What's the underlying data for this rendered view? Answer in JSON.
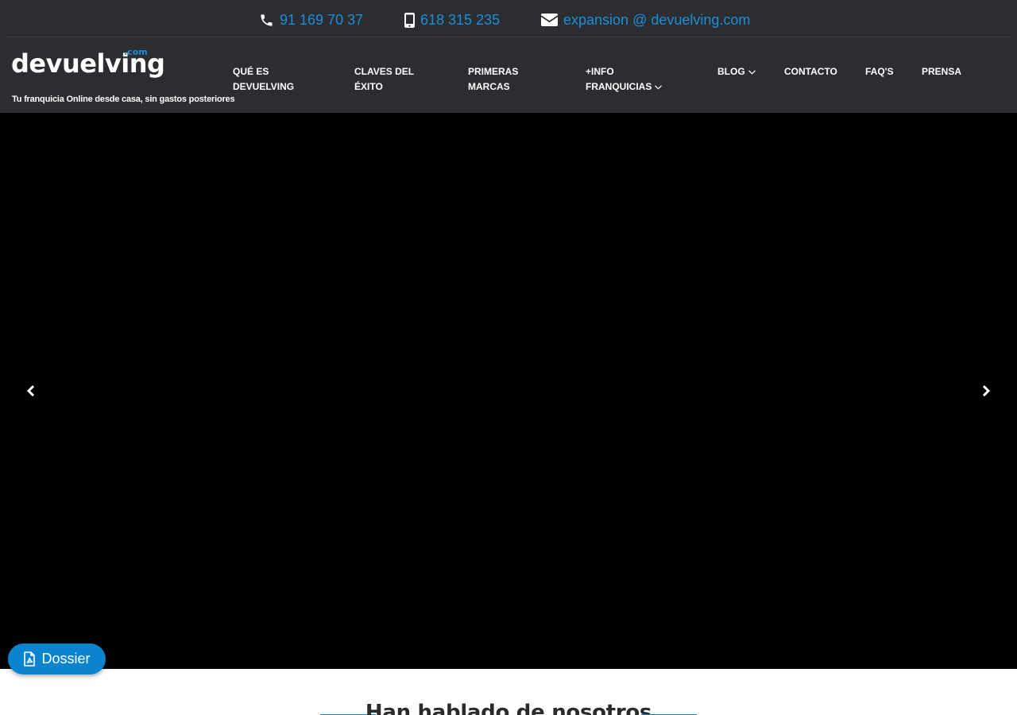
{
  "contact": {
    "phone": "91 169 70 37",
    "mobile": "618 315 235",
    "email": "expansion @ devuelving.com"
  },
  "brand": {
    "logo_text": "devuelving",
    "logo_suffix": ".com",
    "tagline": "Tu franquicia Online desde casa, sin gastos posteriores"
  },
  "nav": {
    "que_es": "QUÉ ES",
    "que_es_2": "DEVUELVING",
    "claves": "CLAVES DEL",
    "claves_2": "ÉXITO",
    "primeras": "PRIMERAS",
    "primeras_2": "MARCAS",
    "info": "+INFO",
    "info_2": "FRANQUICIAS",
    "blog": "BLOG",
    "contacto": "CONTACTO",
    "faq": "FAQ'S",
    "prensa": "PRENSA"
  },
  "dossier": {
    "label": "Dossier"
  },
  "press": {
    "title": "Han hablado de nosotros"
  },
  "icons": {
    "phone": "phone-icon",
    "mobile": "mobile-icon",
    "email": "envelope-icon",
    "chevron": "chevron-down-icon",
    "prev": "chevron-left-icon",
    "next": "chevron-right-icon",
    "pdf": "pdf-file-icon"
  },
  "colors": {
    "header_bg": "#2c2d31",
    "accent": "#0b84cf",
    "link": "#1a8fd8",
    "hero_bg": "#000000"
  }
}
